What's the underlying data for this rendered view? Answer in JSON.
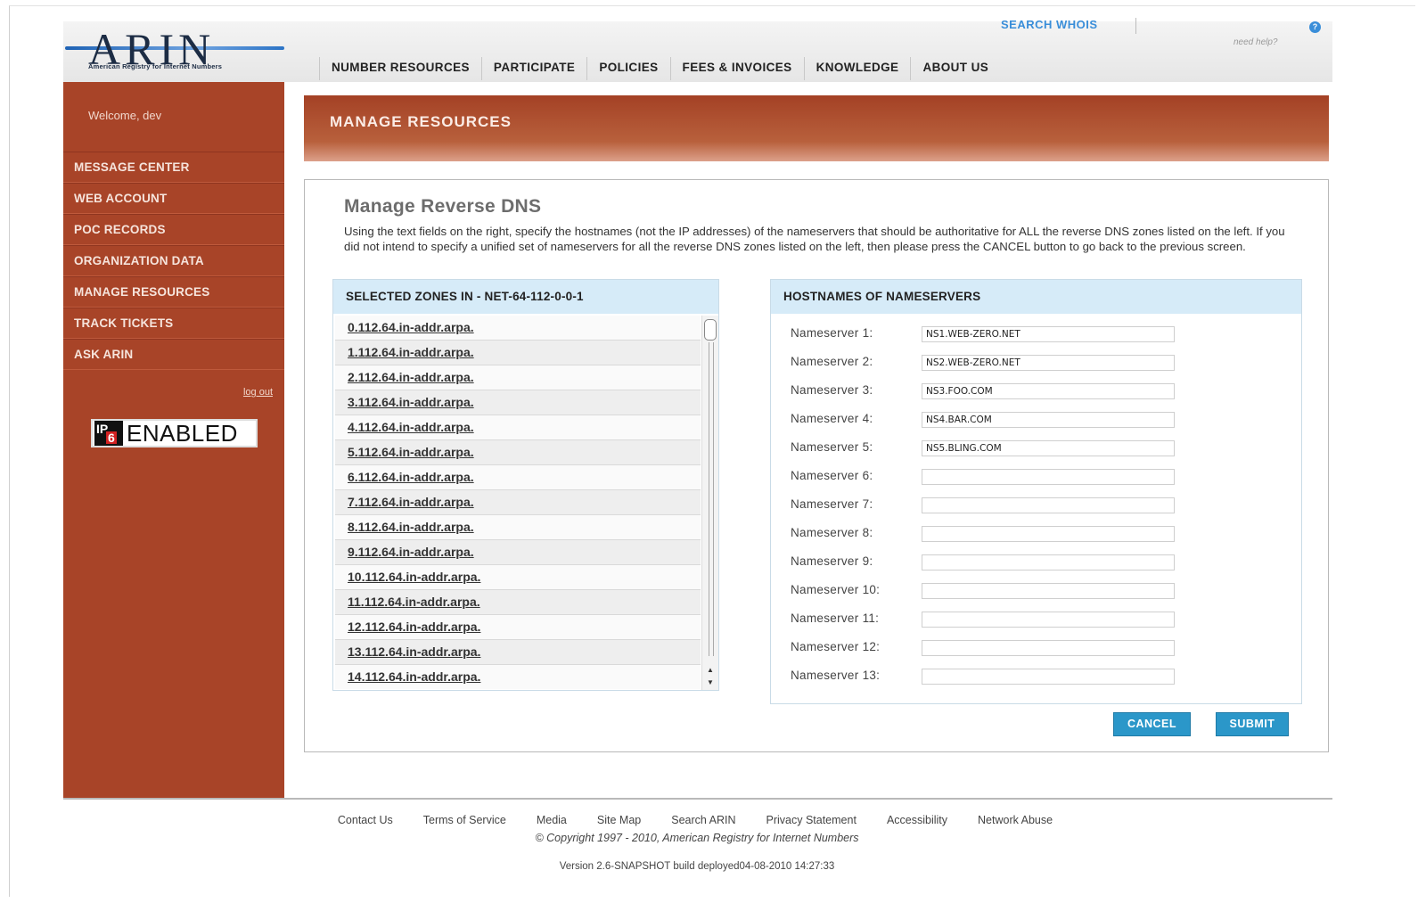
{
  "header": {
    "logo_text": "ARIN",
    "logo_subtitle": "American Registry for Internet Numbers",
    "search_whois": "SEARCH WHOIS",
    "help_icon": "?",
    "need_help": "need help?",
    "nav": [
      "NUMBER RESOURCES",
      "PARTICIPATE",
      "POLICIES",
      "FEES & INVOICES",
      "KNOWLEDGE",
      "ABOUT US"
    ]
  },
  "sidebar": {
    "welcome": "Welcome, dev",
    "items": [
      "MESSAGE CENTER",
      "WEB ACCOUNT",
      "POC RECORDS",
      "ORGANIZATION DATA",
      "MANAGE RESOURCES",
      "TRACK TICKETS",
      "ASK ARIN"
    ],
    "logout": "log out",
    "ipv6_badge": {
      "ip": "IP",
      "six": "6",
      "text": "ENABLED"
    }
  },
  "banner": {
    "title": "MANAGE RESOURCES"
  },
  "main": {
    "title": "Manage Reverse DNS",
    "description": "Using the text fields on the right, specify the hostnames (not the IP addresses) of the nameservers that should be authoritative for ALL the reverse DNS zones listed on the left. If you did not intend to specify a unified set of nameservers for all the reverse DNS zones listed on the left, then please press the CANCEL button to go back to the previous screen.",
    "zones_header": "SELECTED ZONES IN - NET-64-112-0-0-1",
    "zones": [
      "0.112.64.in-addr.arpa.",
      "1.112.64.in-addr.arpa.",
      "2.112.64.in-addr.arpa.",
      "3.112.64.in-addr.arpa.",
      "4.112.64.in-addr.arpa.",
      "5.112.64.in-addr.arpa.",
      "6.112.64.in-addr.arpa.",
      "7.112.64.in-addr.arpa.",
      "8.112.64.in-addr.arpa.",
      "9.112.64.in-addr.arpa.",
      "10.112.64.in-addr.arpa.",
      "11.112.64.in-addr.arpa.",
      "12.112.64.in-addr.arpa.",
      "13.112.64.in-addr.arpa.",
      "14.112.64.in-addr.arpa."
    ],
    "nameservers_header": "HOSTNAMES OF NAMESERVERS",
    "nameservers": [
      {
        "label": "Nameserver 1:",
        "value": "NS1.WEB-ZERO.NET"
      },
      {
        "label": "Nameserver 2:",
        "value": "NS2.WEB-ZERO.NET"
      },
      {
        "label": "Nameserver 3:",
        "value": "NS3.FOO.COM"
      },
      {
        "label": "Nameserver 4:",
        "value": "NS4.BAR.COM"
      },
      {
        "label": "Nameserver 5:",
        "value": "NS5.BLING.COM"
      },
      {
        "label": "Nameserver 6:",
        "value": ""
      },
      {
        "label": "Nameserver 7:",
        "value": ""
      },
      {
        "label": "Nameserver 8:",
        "value": ""
      },
      {
        "label": "Nameserver 9:",
        "value": ""
      },
      {
        "label": "Nameserver 10:",
        "value": ""
      },
      {
        "label": "Nameserver 11:",
        "value": ""
      },
      {
        "label": "Nameserver 12:",
        "value": ""
      },
      {
        "label": "Nameserver 13:",
        "value": ""
      }
    ],
    "cancel_label": "CANCEL",
    "submit_label": "SUBMIT"
  },
  "footer": {
    "links": [
      "Contact Us",
      "Terms of Service",
      "Media",
      "Site Map",
      "Search ARIN",
      "Privacy Statement",
      "Accessibility",
      "Network Abuse"
    ],
    "copyright": "© Copyright 1997 - 2010, American Registry for Internet Numbers",
    "version": "Version 2.6-SNAPSHOT build deployed04-08-2010 14:27:33"
  },
  "colors": {
    "sidebar": "#a84428",
    "banner": "#a44125",
    "panel_head": "#d6ebf8",
    "button": "#2b97c9",
    "link_blue": "#3a8ed9"
  }
}
